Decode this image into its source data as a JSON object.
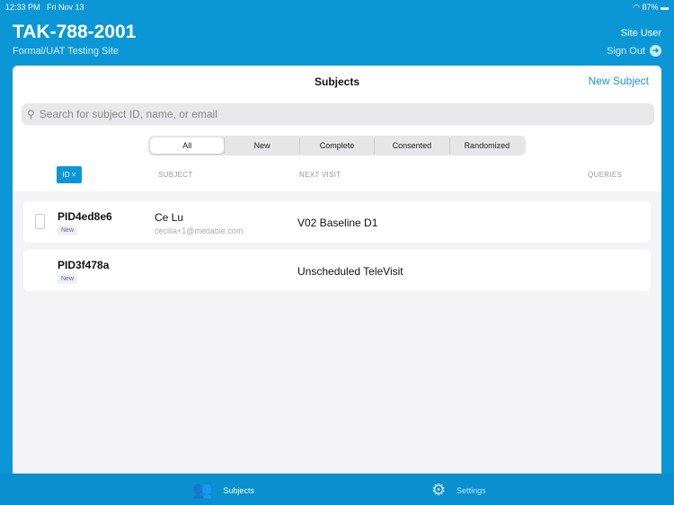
{
  "status": {
    "time": "12:33 PM",
    "date": "Fri Nov 13",
    "battery": "87%"
  },
  "header": {
    "title": "TAK-788-2001",
    "subtitle": "Formal/UAT Testing Site",
    "user": "Site User",
    "sign_out": "Sign Out"
  },
  "main": {
    "title": "Subjects",
    "new_subject": "New Subject",
    "search_placeholder": "Search for subject ID, name, or email",
    "filters": [
      "All",
      "New",
      "Complete",
      "Consented",
      "Randomized"
    ],
    "columns": {
      "id": "ID",
      "subject": "SUBJECT",
      "next_visit": "NEXT VISIT",
      "queries": "QUERIES"
    },
    "rows": [
      {
        "id": "PID4ed8e6",
        "status": "New",
        "name": "Ce Lu",
        "email": "cecilia+1@medable.com",
        "next_visit": "V02 Baseline D1"
      },
      {
        "id": "PID3f478a",
        "status": "New",
        "name": "",
        "email": "",
        "next_visit": "Unscheduled TeleVisit"
      }
    ]
  },
  "tabs": [
    {
      "label": "Subjects"
    },
    {
      "label": "Settings"
    }
  ]
}
